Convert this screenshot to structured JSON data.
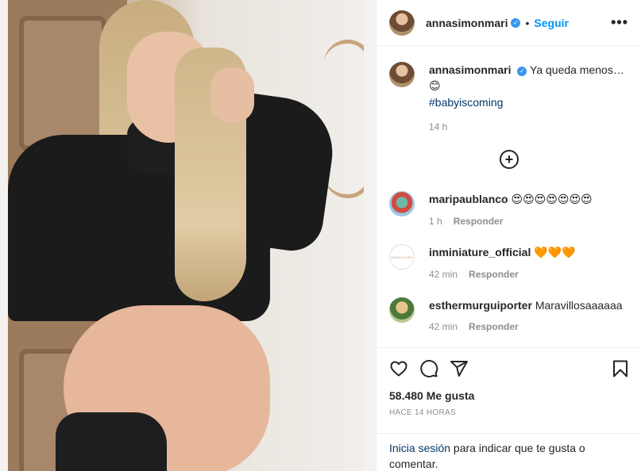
{
  "post": {
    "author": "annasimonmari",
    "follow_label": "Seguir",
    "separator": "•",
    "more_label": "•••"
  },
  "caption": {
    "author": "annasimonmari",
    "text": "Ya queda menos…",
    "emoji": "😊",
    "hashtag": "#babyiscoming",
    "time": "14 h"
  },
  "load_more_label": "+",
  "comments": [
    {
      "author": "maripaublanco",
      "text": "😍😍😍😍😍😍😍",
      "time": "1 h",
      "reply": "Responder"
    },
    {
      "author": "inminiature_official",
      "text": "🧡🧡🧡",
      "time": "42 min",
      "reply": "Responder",
      "avatar_text": "INMINIATURE"
    },
    {
      "author": "esthermurguiporter",
      "text": "Maravillosaaaaaa",
      "time": "42 min",
      "reply": "Responder"
    }
  ],
  "actions": {
    "likes": "58.480 Me gusta",
    "date": "HACE 14 HORAS"
  },
  "login": {
    "link": "Inicia sesión",
    "text": " para indicar que te gusta o comentar."
  },
  "icons": [
    "verified-badge",
    "more-icon",
    "add-circle-icon",
    "heart-icon",
    "comment-icon",
    "share-icon",
    "bookmark-icon"
  ]
}
